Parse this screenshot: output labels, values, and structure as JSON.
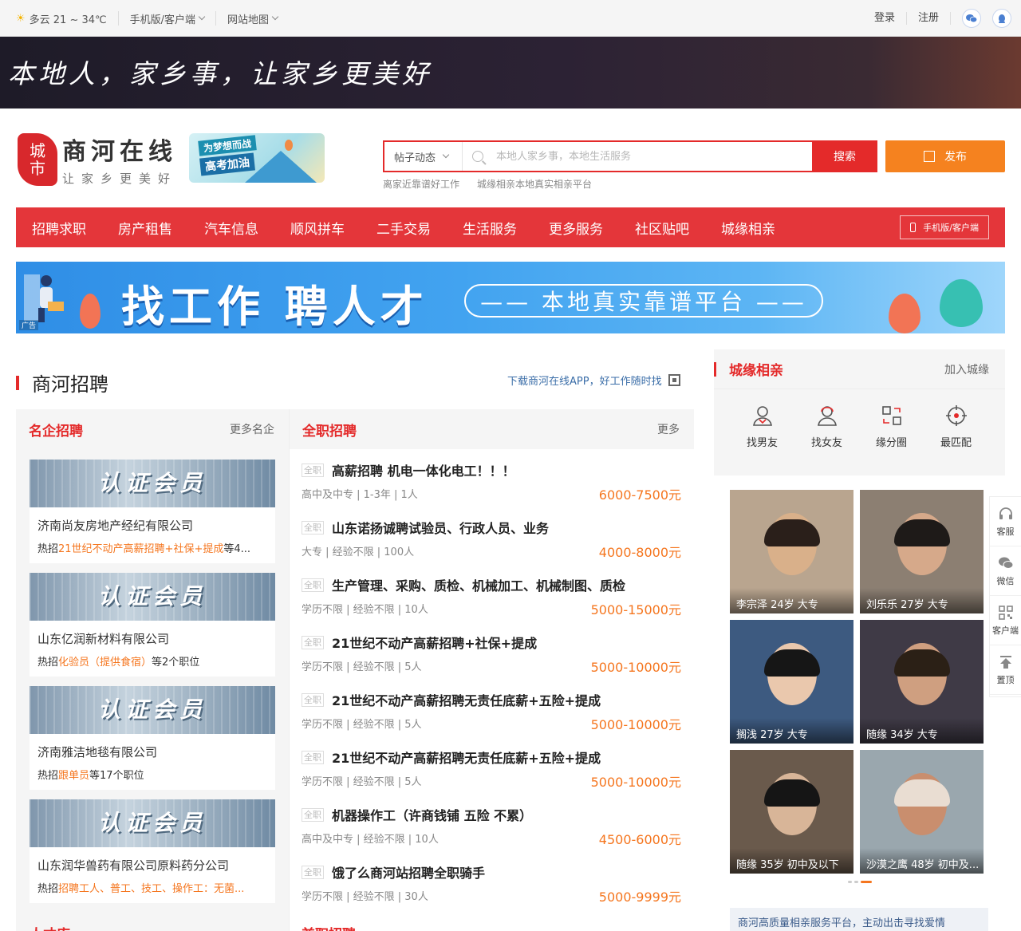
{
  "topbar": {
    "weather": "多云 21 ~ 34℃",
    "mobile": "手机版/客户端",
    "sitemap": "网站地图",
    "login": "登录",
    "register": "注册"
  },
  "banner": {
    "slogan": "本地人，家乡事，让家乡更美好"
  },
  "logo": {
    "badge_top": "城",
    "badge_bottom": "市",
    "name": "商河在线",
    "sub": "让家乡更美好"
  },
  "promo": {
    "line1": "为梦想而战",
    "line2": "高考加油"
  },
  "search": {
    "category": "帖子动态",
    "placeholder": "本地人家乡事，本地生活服务",
    "button": "搜索",
    "hot": [
      "离家近靠谱好工作",
      "城缘相亲本地真实相亲平台"
    ]
  },
  "publish": "发布",
  "nav": {
    "items": [
      "招聘求职",
      "房产租售",
      "汽车信息",
      "顺风拼车",
      "二手交易",
      "生活服务",
      "更多服务",
      "社区贴吧",
      "城缘相亲"
    ],
    "mobile": "手机版/客户端"
  },
  "ad": {
    "main": "找工作 聘人才",
    "pill": "—— 本地真实靠谱平台 ——",
    "tag": "广告"
  },
  "section": {
    "title": "商河招聘",
    "link": "下载商河在线APP，好工作随时找"
  },
  "famous": {
    "title": "名企招聘",
    "more": "更多名企",
    "cert": "认证会员",
    "hot_prefix": "热招",
    "companies": [
      {
        "name": "济南尚友房地产经纪有限公司",
        "jobs": "21世纪不动产高薪招聘+社保+提成",
        "suffix": "等4..."
      },
      {
        "name": "山东亿润新材料有限公司",
        "jobs": "化验员（提供食宿）",
        "suffix": "等2个职位"
      },
      {
        "name": "济南雅洁地毯有限公司",
        "jobs": "跟单员",
        "suffix": "等17个职位"
      },
      {
        "name": "山东润华兽药有限公司原料药分公司",
        "jobs": "招聘工人、普工、技工、操作工：无菌...",
        "suffix": ""
      }
    ]
  },
  "fulltime": {
    "title": "全职招聘",
    "more": "更多",
    "tag": "全职",
    "jobs": [
      {
        "title": "高薪招聘 机电一体化电工！！！",
        "meta": "高中及中专 | 1-3年 | 1人",
        "salary": "6000-7500元"
      },
      {
        "title": "山东诺扬诚聘试验员、行政人员、业务",
        "meta": "大专 | 经验不限 | 100人",
        "salary": "4000-8000元"
      },
      {
        "title": "生产管理、采购、质检、机械加工、机械制图、质检",
        "meta": "学历不限 | 经验不限 | 10人",
        "salary": "5000-15000元"
      },
      {
        "title": "21世纪不动产高薪招聘+社保+提成",
        "meta": "学历不限 | 经验不限 | 5人",
        "salary": "5000-10000元"
      },
      {
        "title": "21世纪不动产高薪招聘无责任底薪+五险+提成",
        "meta": "学历不限 | 经验不限 | 5人",
        "salary": "5000-10000元"
      },
      {
        "title": "21世纪不动产高薪招聘无责任底薪+五险+提成",
        "meta": "学历不限 | 经验不限 | 5人",
        "salary": "5000-10000元"
      },
      {
        "title": "机器操作工（许商钱铺 五险 不累）",
        "meta": "高中及中专 | 经验不限 | 10人",
        "salary": "4500-6000元"
      },
      {
        "title": "饿了么商河站招聘全职骑手",
        "meta": "学历不限 | 经验不限 | 30人",
        "salary": "5000-9999元"
      }
    ]
  },
  "dating": {
    "title": "城缘相亲",
    "join": "加入城缘",
    "icons": [
      "找男友",
      "找女友",
      "缘分圈",
      "最匹配"
    ],
    "people": [
      "李宗泽 24岁 大专",
      "刘乐乐 27岁 大专",
      "搁浅 27岁 大专",
      "随缘 34岁 大专",
      "随缘 35岁 初中及以下",
      "沙漠之鹰 48岁 初中及..."
    ],
    "footer": "商河高质量相亲服务平台，主动出击寻找爱情"
  },
  "side": [
    "客服",
    "微信",
    "客户端",
    "置顶"
  ],
  "bottom": {
    "left": "人才库",
    "mid": "兼职招聘"
  },
  "colors": {
    "brand_red": "#e42a2a",
    "orange": "#f5761f",
    "publish": "#f5821f"
  }
}
